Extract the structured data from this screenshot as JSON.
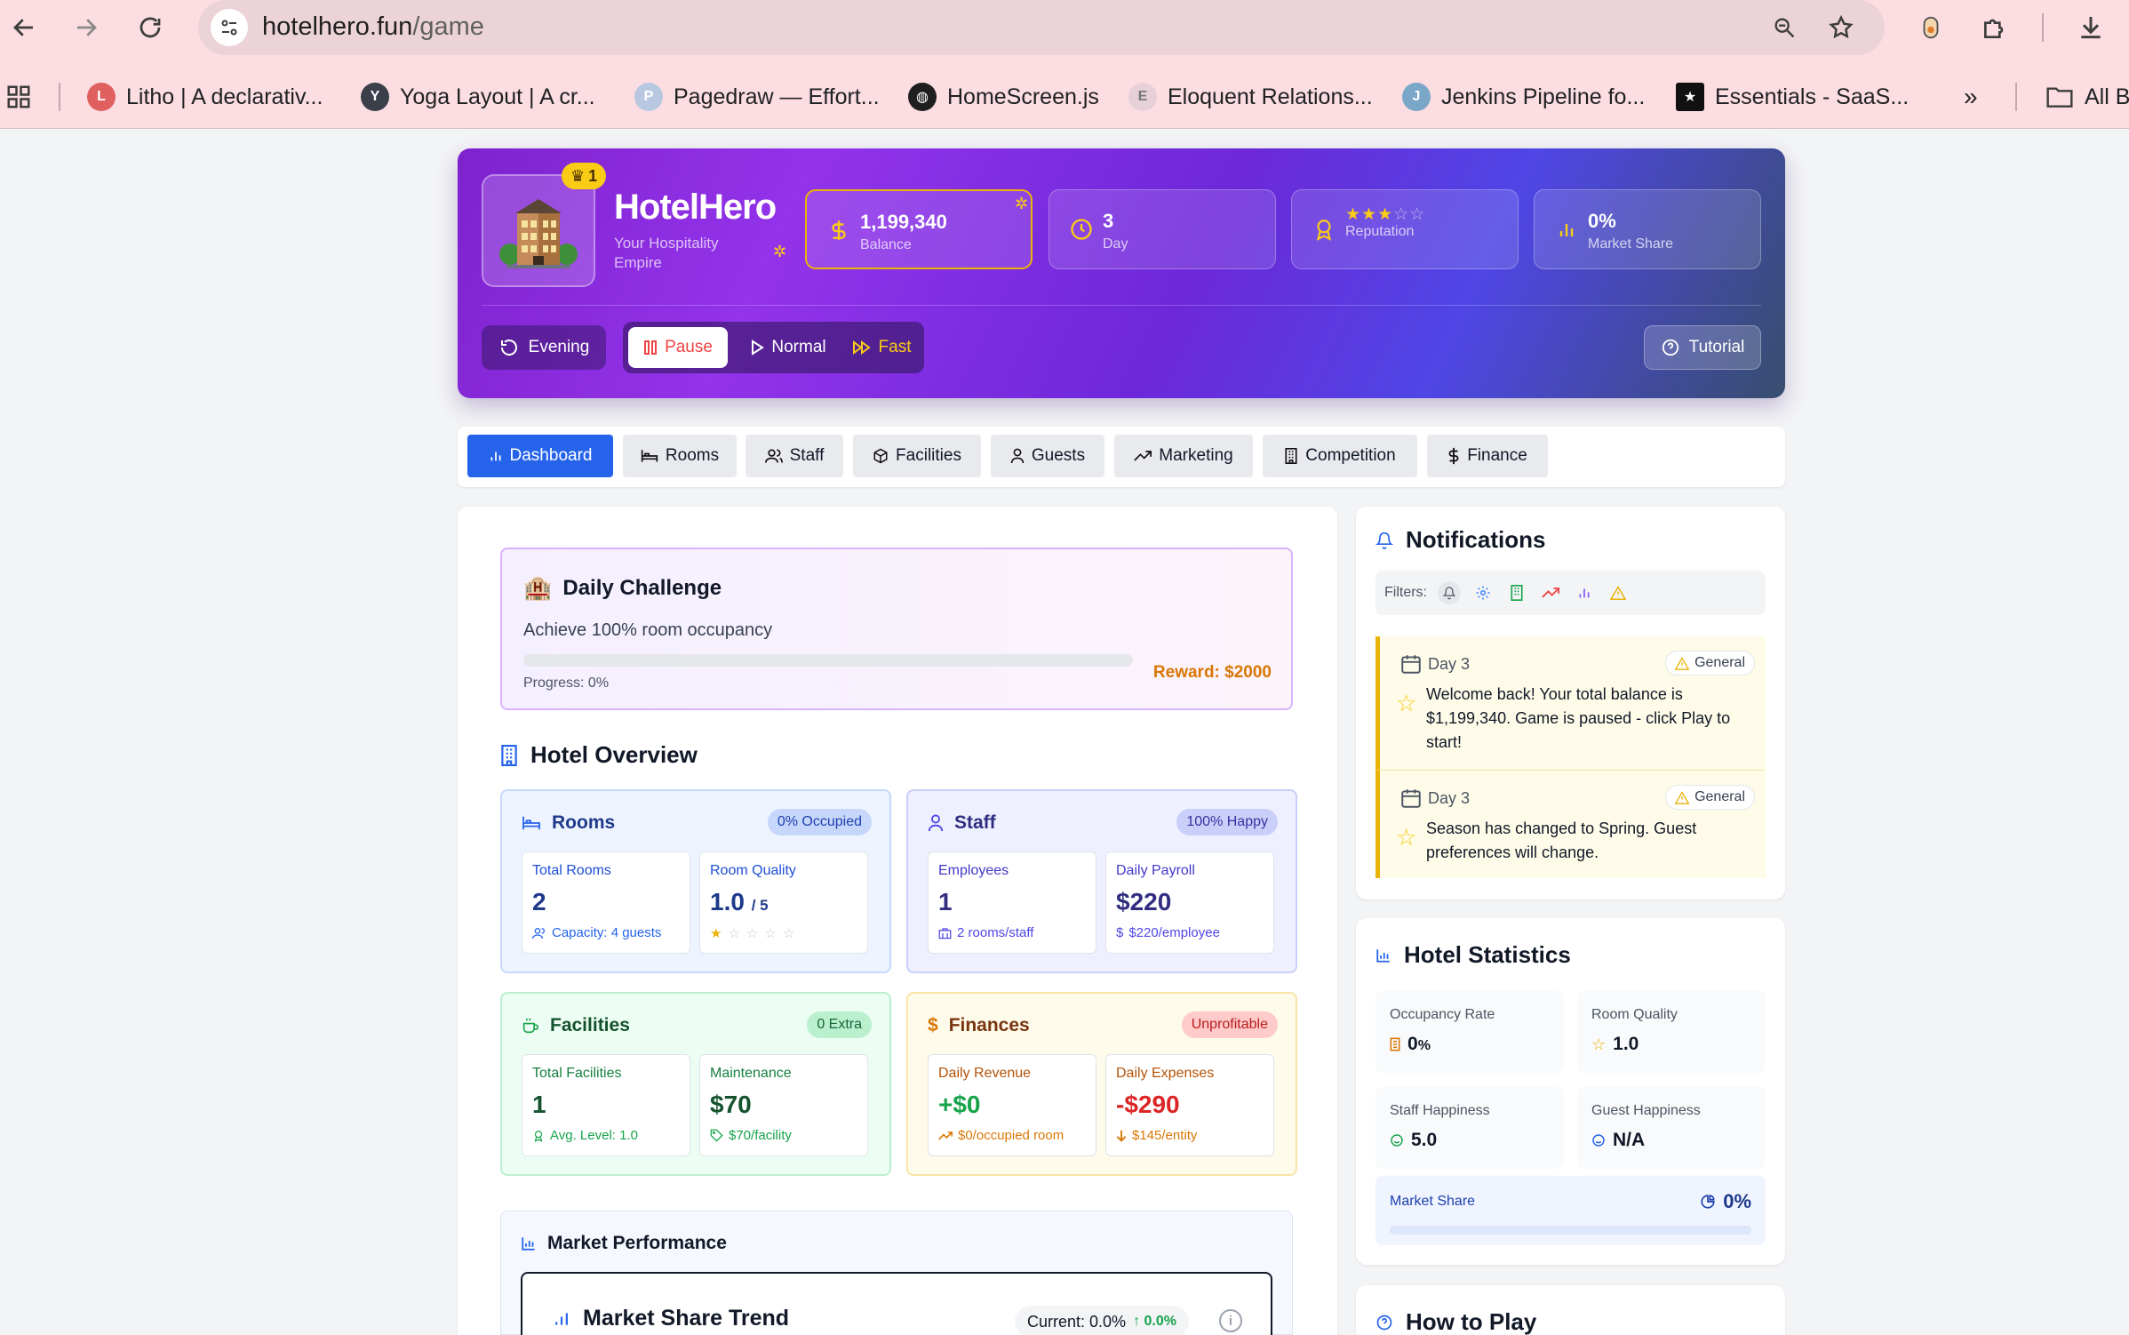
{
  "browser": {
    "url_host": "hotelhero.fun",
    "url_path": "/game",
    "bookmarks": [
      {
        "label": "Litho | A declarativ...",
        "color": "#e06060"
      },
      {
        "label": "Yoga Layout | A cr...",
        "color": "#3a3f4a"
      },
      {
        "label": "Pagedraw — Effort...",
        "color": "#b8c8e0"
      },
      {
        "label": "HomeScreen.js",
        "color": "#1f1f1f"
      },
      {
        "label": "Eloquent Relations...",
        "color": "#e8d0d8"
      },
      {
        "label": "Jenkins Pipeline fo...",
        "color": "#7aa6c8"
      },
      {
        "label": "Essentials - SaaS...",
        "color": "#111111"
      }
    ],
    "all_bookmarks": "All B"
  },
  "header": {
    "level": "1",
    "brand": "HotelHero",
    "tagline": "Your Hospitality Empire",
    "stats": {
      "balance_value": "1,199,340",
      "balance_label": "Balance",
      "day_value": "3",
      "day_label": "Day",
      "reputation_label": "Reputation",
      "reputation_stars": 3,
      "reputation_max": 5,
      "share_value": "0%",
      "share_label": "Market Share"
    },
    "time_of_day": "Evening",
    "speed": {
      "pause": "Pause",
      "normal": "Normal",
      "fast": "Fast"
    },
    "tutorial": "Tutorial"
  },
  "tabs": [
    "Dashboard",
    "Rooms",
    "Staff",
    "Facilities",
    "Guests",
    "Marketing",
    "Competition",
    "Finance"
  ],
  "challenge": {
    "title": "Daily Challenge",
    "description": "Achieve 100% room occupancy",
    "progress": "Progress: 0%",
    "progress_fraction": 0,
    "reward": "Reward: $2000"
  },
  "overview": {
    "title": "Hotel Overview",
    "rooms": {
      "title": "Rooms",
      "badge": "0% Occupied",
      "total_label": "Total Rooms",
      "total_value": "2",
      "capacity": "Capacity: 4 guests",
      "quality_label": "Room Quality",
      "quality_value": "1.0",
      "quality_max": "/ 5",
      "quality_stars": 1
    },
    "staff": {
      "title": "Staff",
      "badge": "100% Happy",
      "employees_label": "Employees",
      "employees_value": "1",
      "ratio": "2 rooms/staff",
      "payroll_label": "Daily Payroll",
      "payroll_value": "$220",
      "per_employee": "$220/employee"
    },
    "facilities": {
      "title": "Facilities",
      "badge": "0 Extra",
      "total_label": "Total Facilities",
      "total_value": "1",
      "avg_level": "Avg. Level: 1.0",
      "maintenance_label": "Maintenance",
      "maintenance_value": "$70",
      "per_facility": "$70/facility"
    },
    "finances": {
      "title": "Finances",
      "badge": "Unprofitable",
      "revenue_label": "Daily Revenue",
      "revenue_value": "+$0",
      "per_room": "$0/occupied room",
      "expenses_label": "Daily Expenses",
      "expenses_value": "-$290",
      "per_entity": "$145/entity"
    }
  },
  "market": {
    "title": "Market Performance",
    "trend_title": "Market Share Trend",
    "current": "Current: 0.0%",
    "change": "0.0%",
    "info": "i"
  },
  "notifications": {
    "title": "Notifications",
    "filters_label": "Filters:",
    "items": [
      {
        "day": "Day 3",
        "category": "General",
        "text": "Welcome back! Your total balance is $1,199,340. Game is paused - click Play to start!"
      },
      {
        "day": "Day 3",
        "category": "General",
        "text": "Season has changed to Spring. Guest preferences will change."
      }
    ]
  },
  "statistics": {
    "title": "Hotel Statistics",
    "occupancy_label": "Occupancy Rate",
    "occupancy_value": "0",
    "occupancy_unit": "%",
    "quality_label": "Room Quality",
    "quality_value": "1.0",
    "staff_label": "Staff Happiness",
    "staff_value": "5.0",
    "guest_label": "Guest Happiness",
    "guest_value": "N/A",
    "share_label": "Market Share",
    "share_value": "0%",
    "share_fraction": 0
  },
  "how_to_play": {
    "title": "How to Play"
  }
}
